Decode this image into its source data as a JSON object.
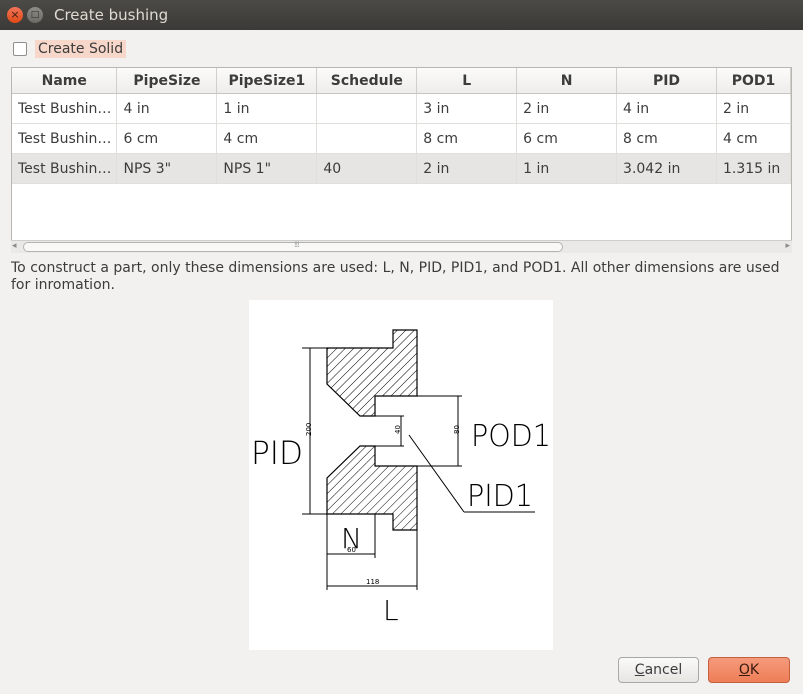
{
  "window": {
    "title": "Create bushing",
    "close_glyph": "×",
    "max_glyph": "□"
  },
  "create_solid": {
    "label": "Create Solid",
    "checked": false
  },
  "table": {
    "columns": [
      "Name",
      "PipeSize",
      "PipeSize1",
      "Schedule",
      "L",
      "N",
      "PID",
      "POD1"
    ],
    "rows": [
      [
        "Test Bushin…",
        "4 in",
        "1 in",
        "",
        "3 in",
        "2 in",
        "4 in",
        "2 in"
      ],
      [
        "Test Bushin…",
        "6 cm",
        "4 cm",
        "",
        "8 cm",
        "6 cm",
        "8 cm",
        "4 cm"
      ],
      [
        "Test Bushin…",
        "NPS 3\"",
        "NPS 1\"",
        "40",
        "2 in",
        "1 in",
        "3.042 in",
        "1.315 in"
      ]
    ],
    "selected_row": 2
  },
  "info_text": "To construct a part, only these dimensions are used: L, N, PID, PID1, and POD1. All other dimensions are used for inromation.",
  "diagram": {
    "labels": {
      "pid": "PID",
      "pod1": "POD1",
      "pid1": "PID1",
      "n": "N",
      "l": "L",
      "dim_200": "200",
      "dim_40": "40",
      "dim_80": "80",
      "dim_60": "60",
      "dim_118": "118"
    }
  },
  "buttons": {
    "cancel_prefix": "",
    "cancel_mnemonic": "C",
    "cancel_rest": "ancel",
    "ok_mnemonic": "O",
    "ok_rest": "K"
  }
}
